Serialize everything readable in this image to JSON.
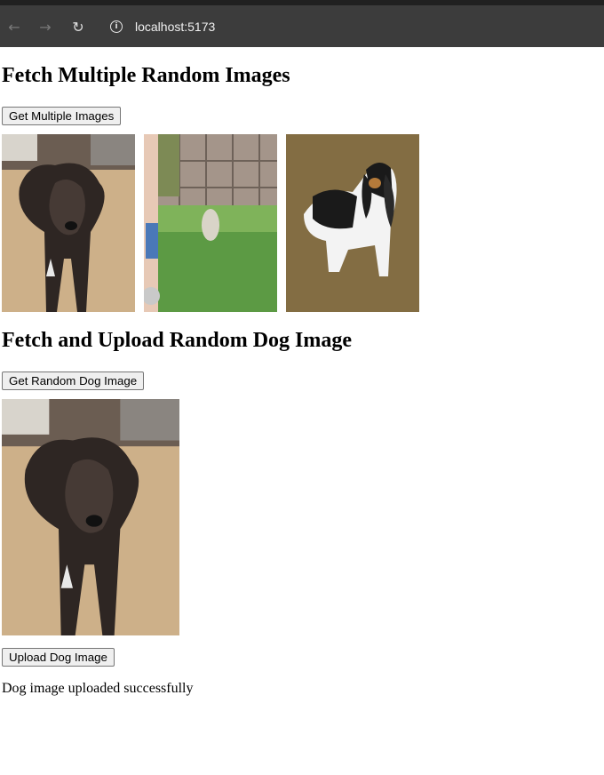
{
  "browser": {
    "url": "localhost:5173",
    "back_icon": "arrow-left-icon",
    "forward_icon": "arrow-right-icon",
    "reload_icon": "reload-icon",
    "site_info_icon": "info-icon"
  },
  "multiple": {
    "heading": "Fetch Multiple Random Images",
    "button_label": "Get Multiple Images",
    "images": [
      {
        "alt": "Random dog image 1"
      },
      {
        "alt": "Random dog image 2"
      },
      {
        "alt": "Random dog image 3"
      }
    ]
  },
  "upload": {
    "heading": "Fetch and Upload Random Dog Image",
    "get_button_label": "Get Random Dog Image",
    "image_alt": "Random dog image",
    "upload_button_label": "Upload Dog Image",
    "status_message": "Dog image uploaded successfully"
  }
}
